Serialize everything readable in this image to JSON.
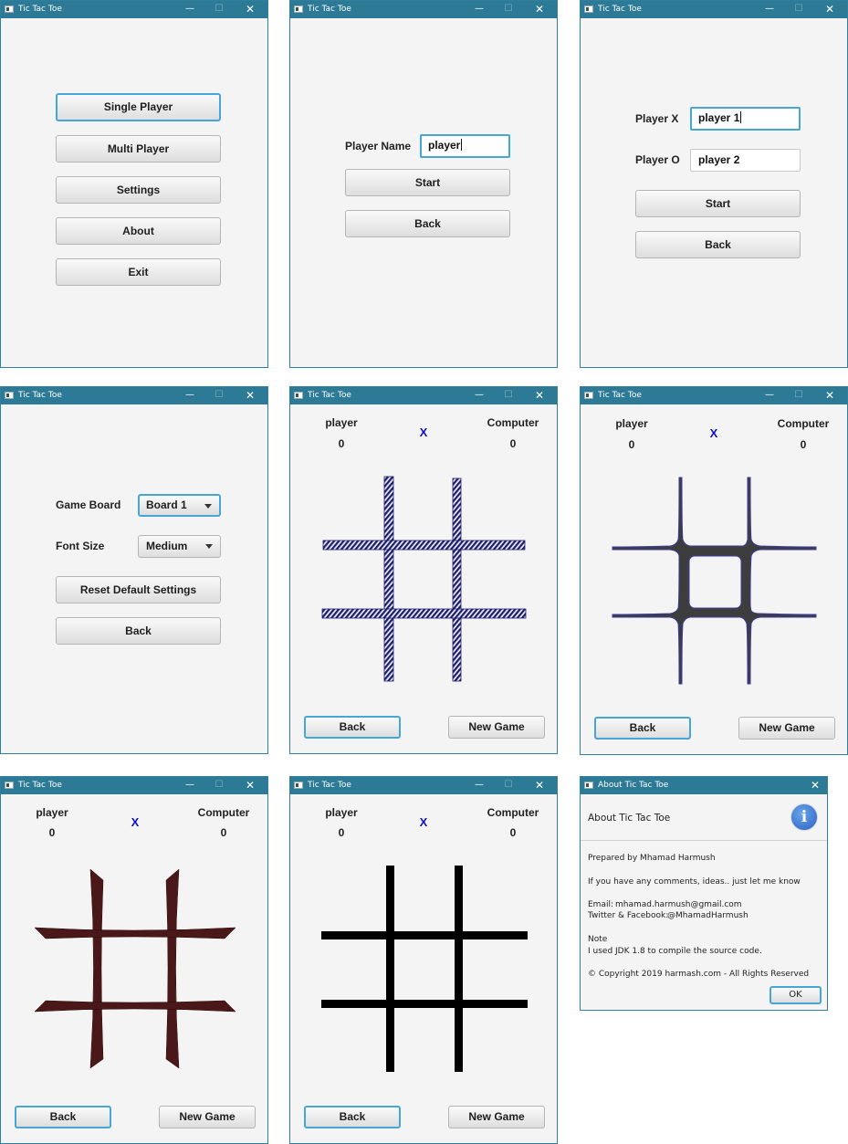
{
  "window_title": "Tic Tac Toe",
  "menu": {
    "single_player": "Single Player",
    "multi_player": "Multi Player",
    "settings": "Settings",
    "about": "About",
    "exit": "Exit"
  },
  "single_setup": {
    "player_name_label": "Player Name",
    "player_name_value": "player",
    "start": "Start",
    "back": "Back"
  },
  "multi_setup": {
    "player_x_label": "Player X",
    "player_x_value": "player 1",
    "player_o_label": "Player O",
    "player_o_value": "player 2",
    "start": "Start",
    "back": "Back"
  },
  "settings": {
    "game_board_label": "Game Board",
    "game_board_value": "Board 1",
    "font_size_label": "Font Size",
    "font_size_value": "Medium",
    "reset": "Reset Default Settings",
    "back": "Back"
  },
  "game": {
    "player_name": "player",
    "player_score": "0",
    "turn": "X",
    "opponent_name": "Computer",
    "opponent_score": "0",
    "back": "Back",
    "new_game": "New Game"
  },
  "boards": [
    {
      "style": "hatched",
      "color": "#1c1c6b"
    },
    {
      "style": "curved",
      "color": "#3d3d3d",
      "outline": "#3a3aa8"
    },
    {
      "style": "tapered",
      "color": "#4a1818"
    },
    {
      "style": "solid",
      "color": "#000000"
    }
  ],
  "about": {
    "window_title": "About Tic Tac Toe",
    "header": "About Tic Tac Toe",
    "info_icon": "i",
    "prepared_by": "Prepared by Mhamad Harmush",
    "comments": "If you have any comments, ideas.. just let me know",
    "email_label": "Email:",
    "email": "mhamad.harmush@gmail.com",
    "social_label": "Twitter & Facebook:",
    "social": "@MhamadHarmush",
    "note_label": "Note",
    "note": "I used JDK 1.8 to compile the source code.",
    "copyright": "© Copyright 2019 harmash.com - All Rights Reserved",
    "ok": "OK"
  },
  "colors": {
    "titlebar": "#2d7a96",
    "window_bg": "#f4f4f4",
    "focus": "#48a6d6",
    "turn": "#1010cc"
  },
  "icons": [
    "app-icon",
    "minimize-icon",
    "maximize-icon",
    "close-icon",
    "combo-arrow-icon",
    "info-icon"
  ]
}
